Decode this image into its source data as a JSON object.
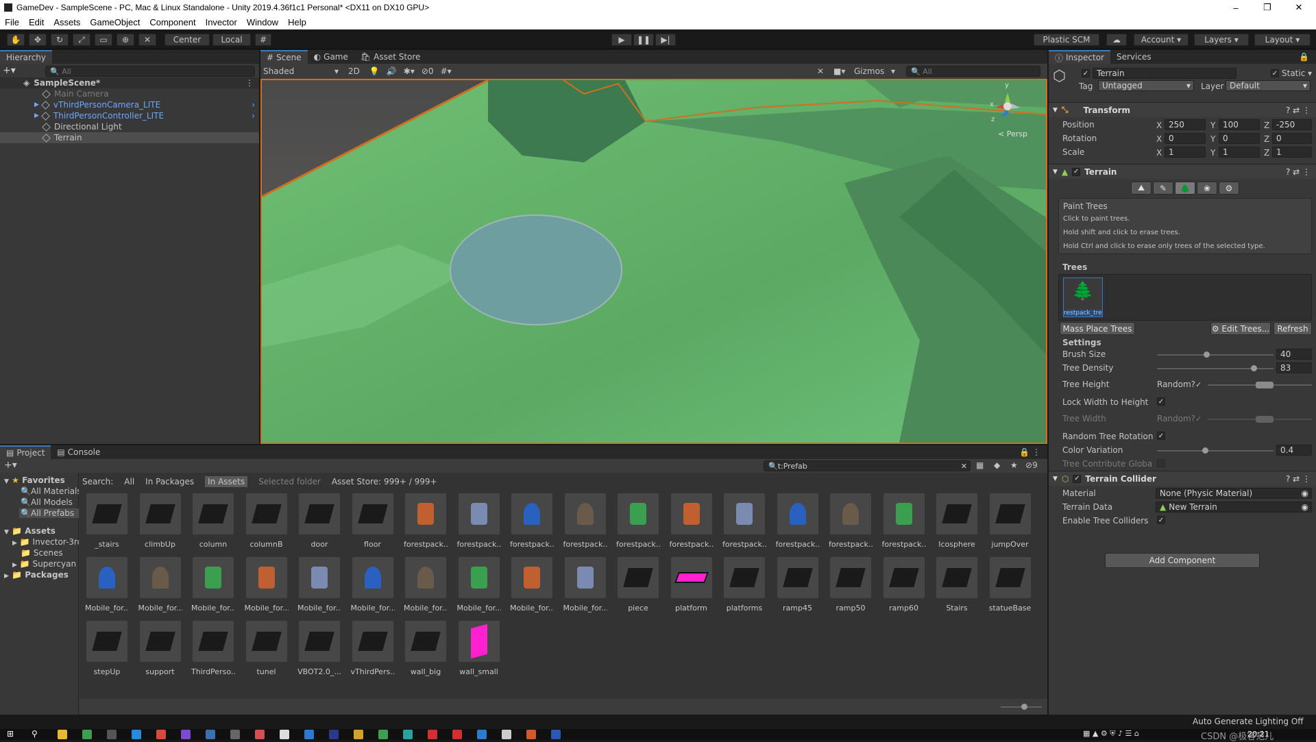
{
  "window": {
    "title": "GameDev - SampleScene - PC, Mac & Linux Standalone - Unity 2019.4.36f1c1 Personal* <DX11 on DX10 GPU>",
    "minimize": "–",
    "maximize": "❐",
    "close": "✕"
  },
  "menu": [
    "File",
    "Edit",
    "Assets",
    "GameObject",
    "Component",
    "Invector",
    "Window",
    "Help"
  ],
  "toolbar": {
    "center": "Center",
    "local": "Local",
    "plastic": "Plastic SCM",
    "account": "Account",
    "layers": "Layers",
    "layout": "Layout"
  },
  "hierarchy": {
    "tab": "Hierarchy",
    "search_placeholder": "All",
    "scene": "SampleScene*",
    "items": [
      "Main Camera",
      "vThirdPersonCamera_LITE",
      "ThirdPersonController_LITE",
      "Directional Light",
      "Terrain"
    ]
  },
  "scene": {
    "tabs": [
      "Scene",
      "Game",
      "Asset Store"
    ],
    "shading": "Shaded",
    "mode2d": "2D",
    "hidden_count": "0",
    "gizmos": "Gizmos",
    "search_placeholder": "All",
    "persp": "< Persp",
    "axes": {
      "x": "x",
      "y": "y",
      "z": "z"
    }
  },
  "inspector": {
    "tabs": [
      "Inspector",
      "Services"
    ],
    "object_name": "Terrain",
    "static": "Static",
    "tag_label": "Tag",
    "tag": "Untagged",
    "layer_label": "Layer",
    "layer": "Default",
    "transform": {
      "title": "Transform",
      "rows": [
        {
          "label": "Position",
          "x": "250",
          "y": "100",
          "z": "-250"
        },
        {
          "label": "Rotation",
          "x": "0",
          "y": "0",
          "z": "0"
        },
        {
          "label": "Scale",
          "x": "1",
          "y": "1",
          "z": "1"
        }
      ]
    },
    "terrain": {
      "title": "Terrain",
      "mode": "Paint Trees",
      "help1": "Click to paint trees.",
      "help2": "Hold shift and click to erase trees.",
      "help3": "Hold Ctrl and click to erase only trees of the selected type.",
      "trees_label": "Trees",
      "tree_item": "restpack_tre",
      "mass_place": "Mass Place Trees",
      "edit_trees": "Edit Trees...",
      "refresh": "Refresh",
      "settings": "Settings",
      "brush_size_label": "Brush Size",
      "brush_size": "40",
      "tree_density_label": "Tree Density",
      "tree_density": "83",
      "tree_height_label": "Tree Height",
      "random_label": "Random?",
      "lock_label": "Lock Width to Height",
      "tree_width_label": "Tree Width",
      "random_rotation_label": "Random Tree Rotation",
      "color_variation_label": "Color Variation",
      "color_variation": "0.4",
      "contribute_gi_label": "Tree Contribute Global I"
    },
    "collider": {
      "title": "Terrain Collider",
      "material_label": "Material",
      "material": "None (Physic Material)",
      "data_label": "Terrain Data",
      "data": "New Terrain",
      "enable_label": "Enable Tree Colliders"
    },
    "add_component": "Add Component"
  },
  "project": {
    "tabs": [
      "Project",
      "Console"
    ],
    "search_value": "t:Prefab",
    "hidden_count": "9",
    "search_label": "Search:",
    "scopes": [
      "All",
      "In Packages",
      "In Assets",
      "Selected folder",
      "Asset Store: 999+ / 999+"
    ],
    "favorites": "Favorites",
    "fav_items": [
      "All Materials",
      "All Models",
      "All Prefabs"
    ],
    "assets_root": "Assets",
    "asset_folders": [
      "Invector-3rd",
      "Scenes",
      "Supercyan Fr"
    ],
    "packages": "Packages",
    "items": [
      "_stairs",
      "climbUp",
      "column",
      "columnB",
      "door",
      "floor",
      "forestpack...",
      "forestpack...",
      "forestpack...",
      "forestpack...",
      "forestpack...",
      "forestpack...",
      "forestpack...",
      "forestpack...",
      "forestpack...",
      "forestpack...",
      "Icosphere",
      "jumpOver",
      "Mobile_for...",
      "Mobile_for...",
      "Mobile_for...",
      "Mobile_for...",
      "Mobile_for...",
      "Mobile_for...",
      "Mobile_for...",
      "Mobile_for...",
      "Mobile_for...",
      "Mobile_for...",
      "piece",
      "platform",
      "platforms",
      "ramp45",
      "ramp50",
      "ramp60",
      "Stairs",
      "statueBase",
      "stepUp",
      "support",
      "ThirdPerso...",
      "tunel",
      "VBOT2.0_...",
      "vThirdPers...",
      "wall_big",
      "wall_small"
    ]
  },
  "status": {
    "lighting": "Auto Generate Lighting Off"
  },
  "taskbar": {
    "time": "20:21",
    "watermark": "CSDN @极客范儿"
  },
  "colors": {
    "accent": "#3a79bb",
    "terrain_green": "#6fbf73",
    "selection_outline": "#cf6f20"
  }
}
